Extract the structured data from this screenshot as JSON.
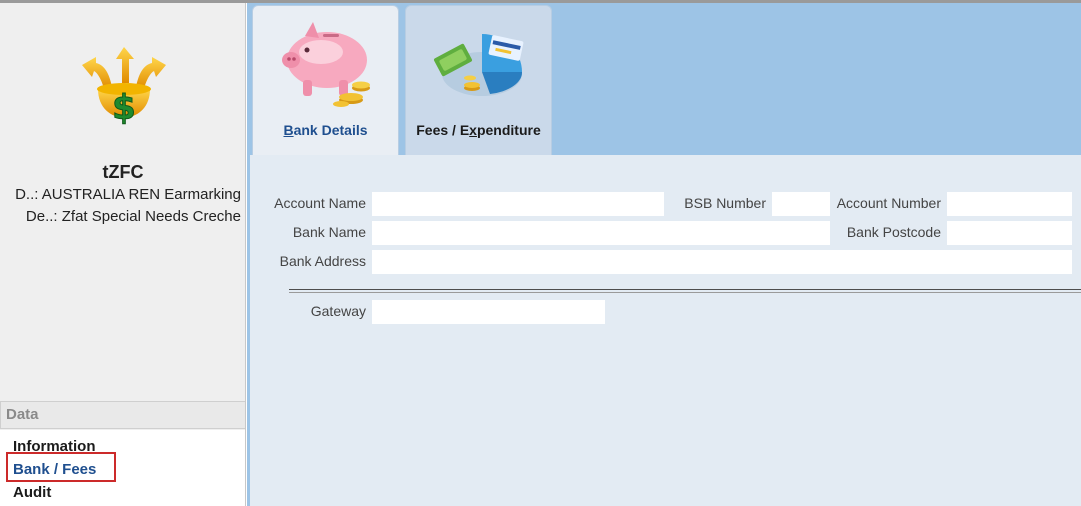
{
  "sidebar": {
    "entity_name": "tZFC",
    "meta_line_1": "D..: AUSTRALIA REN Earmarking",
    "meta_line_2": "De..: Zfat Special Needs Creche",
    "section_header": "Data",
    "items": [
      {
        "label": "Information"
      },
      {
        "label": "Bank / Fees"
      },
      {
        "label": "Audit"
      }
    ]
  },
  "tabs": [
    {
      "label_pre": "",
      "label_u": "B",
      "label_post": "ank Details",
      "icon": "piggy-bank-icon"
    },
    {
      "label_pre": "Fees / E",
      "label_u": "x",
      "label_post": "penditure",
      "icon": "fees-chart-icon"
    }
  ],
  "form": {
    "account_name_label": "Account Name",
    "bsb_label": "BSB Number",
    "account_number_label": "Account Number",
    "bank_name_label": "Bank Name",
    "bank_postcode_label": "Bank Postcode",
    "bank_address_label": "Bank Address",
    "gateway_label": "Gateway",
    "account_name_value": "",
    "bsb_value": "",
    "account_number_value": "",
    "bank_name_value": "",
    "bank_postcode_value": "",
    "bank_address_value": "",
    "gateway_value": ""
  },
  "colors": {
    "accent_blue": "#1f4f8f",
    "tab_bar": "#9dc4e6",
    "content_bg": "#e3ebf3",
    "highlight_red": "#cc2a2a"
  }
}
